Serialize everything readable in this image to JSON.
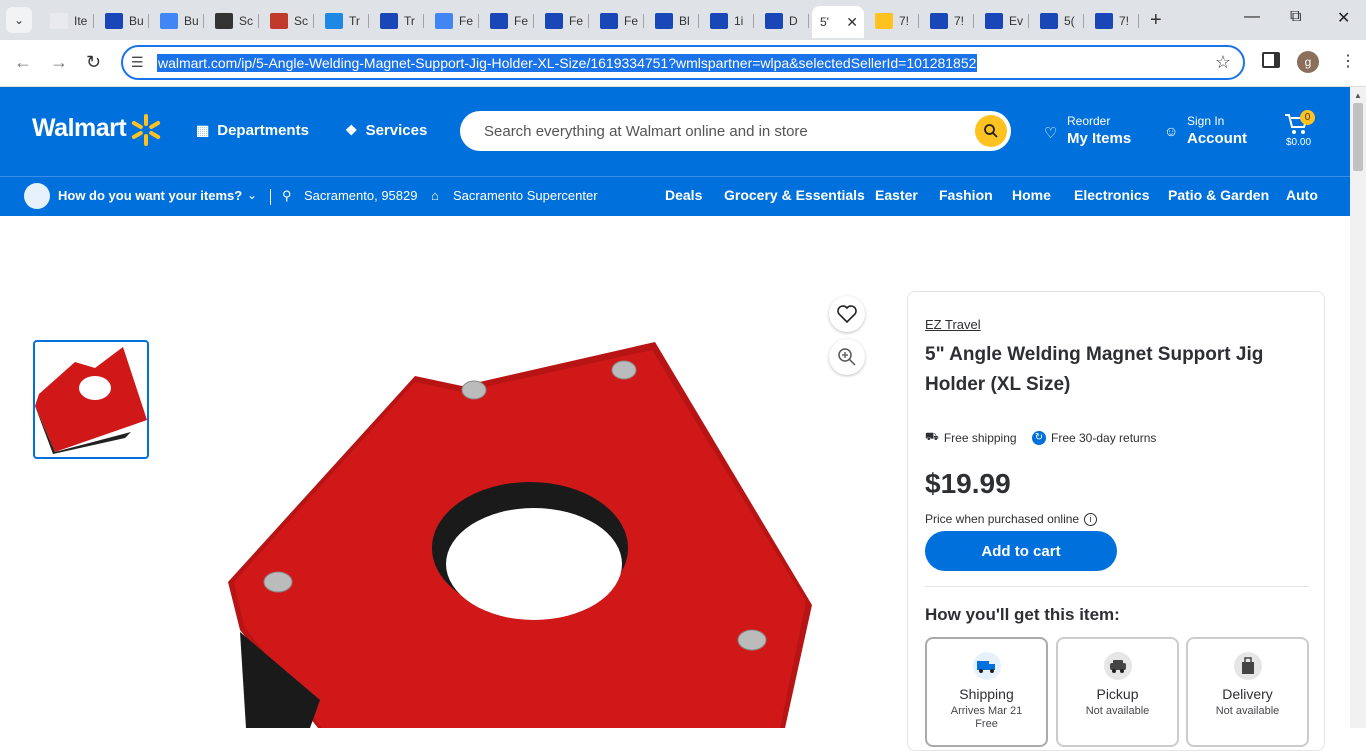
{
  "browser": {
    "tabs": [
      {
        "label": "Ite",
        "color": "#e8eaed"
      },
      {
        "label": "Bu",
        "color": "#1a47b8"
      },
      {
        "label": "Bu",
        "color": "#4285f4"
      },
      {
        "label": "Sc",
        "color": "#333333"
      },
      {
        "label": "Sc",
        "color": "#c0392b"
      },
      {
        "label": "Tr",
        "color": "#1e88e5"
      },
      {
        "label": "Tr",
        "color": "#1a47b8"
      },
      {
        "label": "Fe",
        "color": "#4285f4"
      },
      {
        "label": "Fe",
        "color": "#1a47b8"
      },
      {
        "label": "Fe",
        "color": "#1a47b8"
      },
      {
        "label": "Fe",
        "color": "#1a47b8"
      },
      {
        "label": "Bl",
        "color": "#1a47b8"
      },
      {
        "label": "1i",
        "color": "#1a47b8"
      },
      {
        "label": "D",
        "color": "#1a47b8"
      },
      {
        "label": "5'",
        "color": "#ffffff",
        "active": true
      },
      {
        "label": "7!",
        "color": "#ffc220"
      },
      {
        "label": "7!",
        "color": "#1a47b8"
      },
      {
        "label": "Ev",
        "color": "#1a47b8"
      },
      {
        "label": "5(",
        "color": "#1a47b8"
      },
      {
        "label": "7!",
        "color": "#1a47b8"
      }
    ],
    "url": "walmart.com/ip/5-Angle-Welding-Magnet-Support-Jig-Holder-XL-Size/1619334751?wmlspartner=wlpa&selectedSellerId=101281852",
    "profile_initial": "g"
  },
  "header": {
    "logo": "Walmart",
    "departments": "Departments",
    "services": "Services",
    "search_placeholder": "Search everything at Walmart online and in store",
    "reorder_small": "Reorder",
    "reorder_big": "My Items",
    "signin_small": "Sign In",
    "signin_big": "Account",
    "cart_count": "0",
    "cart_total": "$0.00"
  },
  "subnav": {
    "how": "How do you want your items?",
    "location": "Sacramento, 95829",
    "store": "Sacramento Supercenter",
    "categories": [
      "Deals",
      "Grocery & Essentials",
      "Easter",
      "Fashion",
      "Home",
      "Electronics",
      "Patio & Garden",
      "Auto"
    ]
  },
  "product": {
    "brand": "EZ Travel",
    "title": "5\" Angle Welding Magnet Support Jig Holder (XL Size)",
    "free_shipping": "Free shipping",
    "free_returns": "Free 30-day returns",
    "price": "$19.99",
    "price_note": "Price when purchased online",
    "add_to_cart": "Add to cart",
    "how_heading": "How you'll get this item:",
    "options": [
      {
        "name": "Shipping",
        "sub": "Arrives Mar 21",
        "sub2": "Free"
      },
      {
        "name": "Pickup",
        "sub": "Not available",
        "sub2": ""
      },
      {
        "name": "Delivery",
        "sub": "Not available",
        "sub2": ""
      }
    ]
  },
  "colors": {
    "walmart_blue": "#0071dc",
    "spark_yellow": "#ffc220",
    "magnet_red": "#d01818"
  }
}
